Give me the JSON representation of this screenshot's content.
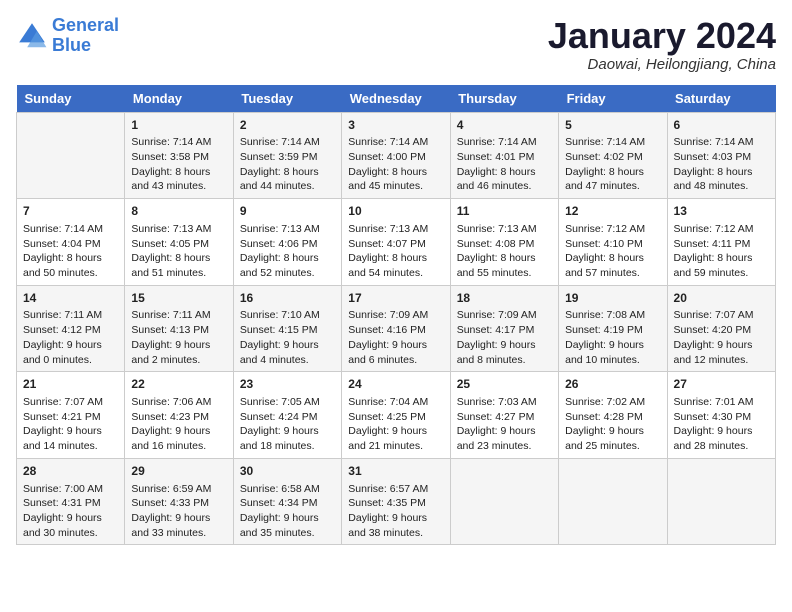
{
  "header": {
    "logo_line1": "General",
    "logo_line2": "Blue",
    "month_title": "January 2024",
    "subtitle": "Daowai, Heilongjiang, China"
  },
  "days_of_week": [
    "Sunday",
    "Monday",
    "Tuesday",
    "Wednesday",
    "Thursday",
    "Friday",
    "Saturday"
  ],
  "weeks": [
    [
      {
        "day": "",
        "sunrise": "",
        "sunset": "",
        "daylight": ""
      },
      {
        "day": "1",
        "sunrise": "Sunrise: 7:14 AM",
        "sunset": "Sunset: 3:58 PM",
        "daylight": "Daylight: 8 hours and 43 minutes."
      },
      {
        "day": "2",
        "sunrise": "Sunrise: 7:14 AM",
        "sunset": "Sunset: 3:59 PM",
        "daylight": "Daylight: 8 hours and 44 minutes."
      },
      {
        "day": "3",
        "sunrise": "Sunrise: 7:14 AM",
        "sunset": "Sunset: 4:00 PM",
        "daylight": "Daylight: 8 hours and 45 minutes."
      },
      {
        "day": "4",
        "sunrise": "Sunrise: 7:14 AM",
        "sunset": "Sunset: 4:01 PM",
        "daylight": "Daylight: 8 hours and 46 minutes."
      },
      {
        "day": "5",
        "sunrise": "Sunrise: 7:14 AM",
        "sunset": "Sunset: 4:02 PM",
        "daylight": "Daylight: 8 hours and 47 minutes."
      },
      {
        "day": "6",
        "sunrise": "Sunrise: 7:14 AM",
        "sunset": "Sunset: 4:03 PM",
        "daylight": "Daylight: 8 hours and 48 minutes."
      }
    ],
    [
      {
        "day": "7",
        "sunrise": "Sunrise: 7:14 AM",
        "sunset": "Sunset: 4:04 PM",
        "daylight": "Daylight: 8 hours and 50 minutes."
      },
      {
        "day": "8",
        "sunrise": "Sunrise: 7:13 AM",
        "sunset": "Sunset: 4:05 PM",
        "daylight": "Daylight: 8 hours and 51 minutes."
      },
      {
        "day": "9",
        "sunrise": "Sunrise: 7:13 AM",
        "sunset": "Sunset: 4:06 PM",
        "daylight": "Daylight: 8 hours and 52 minutes."
      },
      {
        "day": "10",
        "sunrise": "Sunrise: 7:13 AM",
        "sunset": "Sunset: 4:07 PM",
        "daylight": "Daylight: 8 hours and 54 minutes."
      },
      {
        "day": "11",
        "sunrise": "Sunrise: 7:13 AM",
        "sunset": "Sunset: 4:08 PM",
        "daylight": "Daylight: 8 hours and 55 minutes."
      },
      {
        "day": "12",
        "sunrise": "Sunrise: 7:12 AM",
        "sunset": "Sunset: 4:10 PM",
        "daylight": "Daylight: 8 hours and 57 minutes."
      },
      {
        "day": "13",
        "sunrise": "Sunrise: 7:12 AM",
        "sunset": "Sunset: 4:11 PM",
        "daylight": "Daylight: 8 hours and 59 minutes."
      }
    ],
    [
      {
        "day": "14",
        "sunrise": "Sunrise: 7:11 AM",
        "sunset": "Sunset: 4:12 PM",
        "daylight": "Daylight: 9 hours and 0 minutes."
      },
      {
        "day": "15",
        "sunrise": "Sunrise: 7:11 AM",
        "sunset": "Sunset: 4:13 PM",
        "daylight": "Daylight: 9 hours and 2 minutes."
      },
      {
        "day": "16",
        "sunrise": "Sunrise: 7:10 AM",
        "sunset": "Sunset: 4:15 PM",
        "daylight": "Daylight: 9 hours and 4 minutes."
      },
      {
        "day": "17",
        "sunrise": "Sunrise: 7:09 AM",
        "sunset": "Sunset: 4:16 PM",
        "daylight": "Daylight: 9 hours and 6 minutes."
      },
      {
        "day": "18",
        "sunrise": "Sunrise: 7:09 AM",
        "sunset": "Sunset: 4:17 PM",
        "daylight": "Daylight: 9 hours and 8 minutes."
      },
      {
        "day": "19",
        "sunrise": "Sunrise: 7:08 AM",
        "sunset": "Sunset: 4:19 PM",
        "daylight": "Daylight: 9 hours and 10 minutes."
      },
      {
        "day": "20",
        "sunrise": "Sunrise: 7:07 AM",
        "sunset": "Sunset: 4:20 PM",
        "daylight": "Daylight: 9 hours and 12 minutes."
      }
    ],
    [
      {
        "day": "21",
        "sunrise": "Sunrise: 7:07 AM",
        "sunset": "Sunset: 4:21 PM",
        "daylight": "Daylight: 9 hours and 14 minutes."
      },
      {
        "day": "22",
        "sunrise": "Sunrise: 7:06 AM",
        "sunset": "Sunset: 4:23 PM",
        "daylight": "Daylight: 9 hours and 16 minutes."
      },
      {
        "day": "23",
        "sunrise": "Sunrise: 7:05 AM",
        "sunset": "Sunset: 4:24 PM",
        "daylight": "Daylight: 9 hours and 18 minutes."
      },
      {
        "day": "24",
        "sunrise": "Sunrise: 7:04 AM",
        "sunset": "Sunset: 4:25 PM",
        "daylight": "Daylight: 9 hours and 21 minutes."
      },
      {
        "day": "25",
        "sunrise": "Sunrise: 7:03 AM",
        "sunset": "Sunset: 4:27 PM",
        "daylight": "Daylight: 9 hours and 23 minutes."
      },
      {
        "day": "26",
        "sunrise": "Sunrise: 7:02 AM",
        "sunset": "Sunset: 4:28 PM",
        "daylight": "Daylight: 9 hours and 25 minutes."
      },
      {
        "day": "27",
        "sunrise": "Sunrise: 7:01 AM",
        "sunset": "Sunset: 4:30 PM",
        "daylight": "Daylight: 9 hours and 28 minutes."
      }
    ],
    [
      {
        "day": "28",
        "sunrise": "Sunrise: 7:00 AM",
        "sunset": "Sunset: 4:31 PM",
        "daylight": "Daylight: 9 hours and 30 minutes."
      },
      {
        "day": "29",
        "sunrise": "Sunrise: 6:59 AM",
        "sunset": "Sunset: 4:33 PM",
        "daylight": "Daylight: 9 hours and 33 minutes."
      },
      {
        "day": "30",
        "sunrise": "Sunrise: 6:58 AM",
        "sunset": "Sunset: 4:34 PM",
        "daylight": "Daylight: 9 hours and 35 minutes."
      },
      {
        "day": "31",
        "sunrise": "Sunrise: 6:57 AM",
        "sunset": "Sunset: 4:35 PM",
        "daylight": "Daylight: 9 hours and 38 minutes."
      },
      {
        "day": "",
        "sunrise": "",
        "sunset": "",
        "daylight": ""
      },
      {
        "day": "",
        "sunrise": "",
        "sunset": "",
        "daylight": ""
      },
      {
        "day": "",
        "sunrise": "",
        "sunset": "",
        "daylight": ""
      }
    ]
  ]
}
